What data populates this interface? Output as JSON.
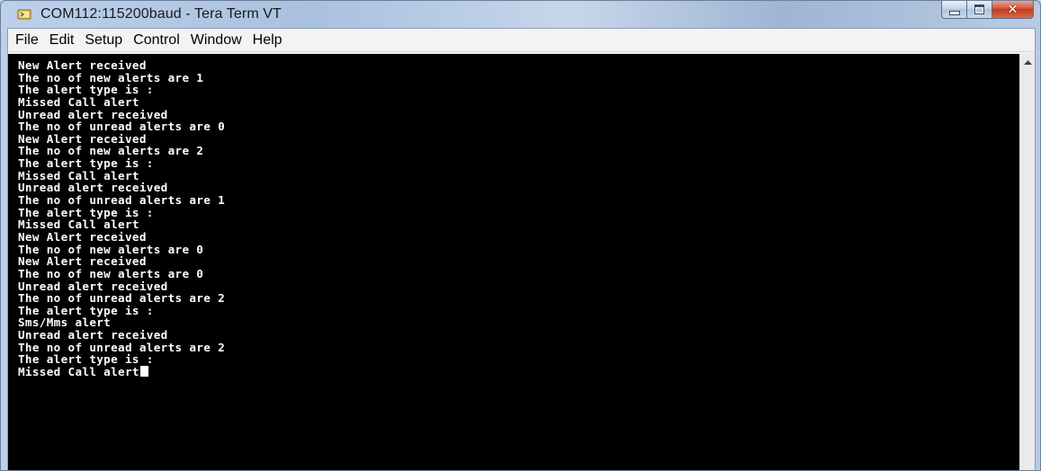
{
  "window": {
    "title": "COM112:115200baud - Tera Term VT"
  },
  "menu": {
    "items": [
      "File",
      "Edit",
      "Setup",
      "Control",
      "Window",
      "Help"
    ]
  },
  "terminal": {
    "lines": [
      "New Alert received",
      "The no of new alerts are 1",
      "The alert type is :",
      "Missed Call alert",
      "Unread alert received",
      "The no of unread alerts are 0",
      "New Alert received",
      "The no of new alerts are 2",
      "The alert type is :",
      "Missed Call alert",
      "Unread alert received",
      "The no of unread alerts are 1",
      "The alert type is :",
      "Missed Call alert",
      "New Alert received",
      "The no of new alerts are 0",
      "New Alert received",
      "The no of new alerts are 0",
      "Unread alert received",
      "The no of unread alerts are 2",
      "The alert type is :",
      "Sms/Mms alert",
      "Unread alert received",
      "The no of unread alerts are 2",
      "The alert type is :",
      "Missed Call alert"
    ]
  },
  "colors": {
    "terminal_bg": "#000000",
    "terminal_fg": "#ffffff",
    "close_button": "#c7442a"
  },
  "icons": {
    "app": "tera-term-icon",
    "minimize": "minimize-icon",
    "maximize": "maximize-icon",
    "close": "close-icon",
    "scroll_up": "scroll-up-arrow-icon"
  }
}
